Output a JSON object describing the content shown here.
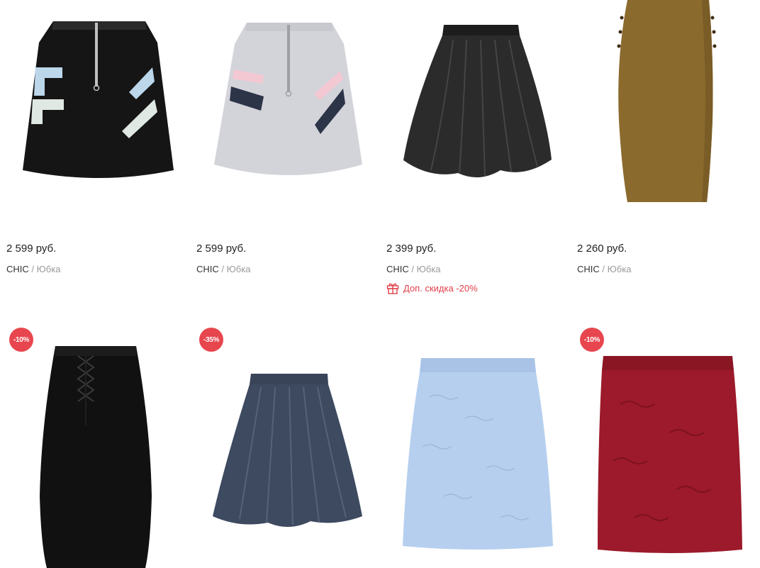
{
  "products": [
    {
      "price": "2 599 руб.",
      "brand": "CHIC",
      "separator": "/",
      "type": "Юбка"
    },
    {
      "price": "2 599 руб.",
      "brand": "CHIC",
      "separator": "/",
      "type": "Юбка"
    },
    {
      "price": "2 399 руб.",
      "brand": "CHIC",
      "separator": "/",
      "type": "Юбка",
      "promo": "Доп. скидка -20%"
    },
    {
      "price": "2 260 руб.",
      "brand": "CHIC",
      "separator": "/",
      "type": "Юбка"
    },
    {
      "badge": "-10%"
    },
    {
      "badge": "-35%"
    },
    {},
    {
      "badge": "-10%"
    }
  ],
  "colors": {
    "promo": "#e0404a",
    "badge": "#e8464f"
  },
  "icons": {
    "promo": "gift-icon"
  }
}
